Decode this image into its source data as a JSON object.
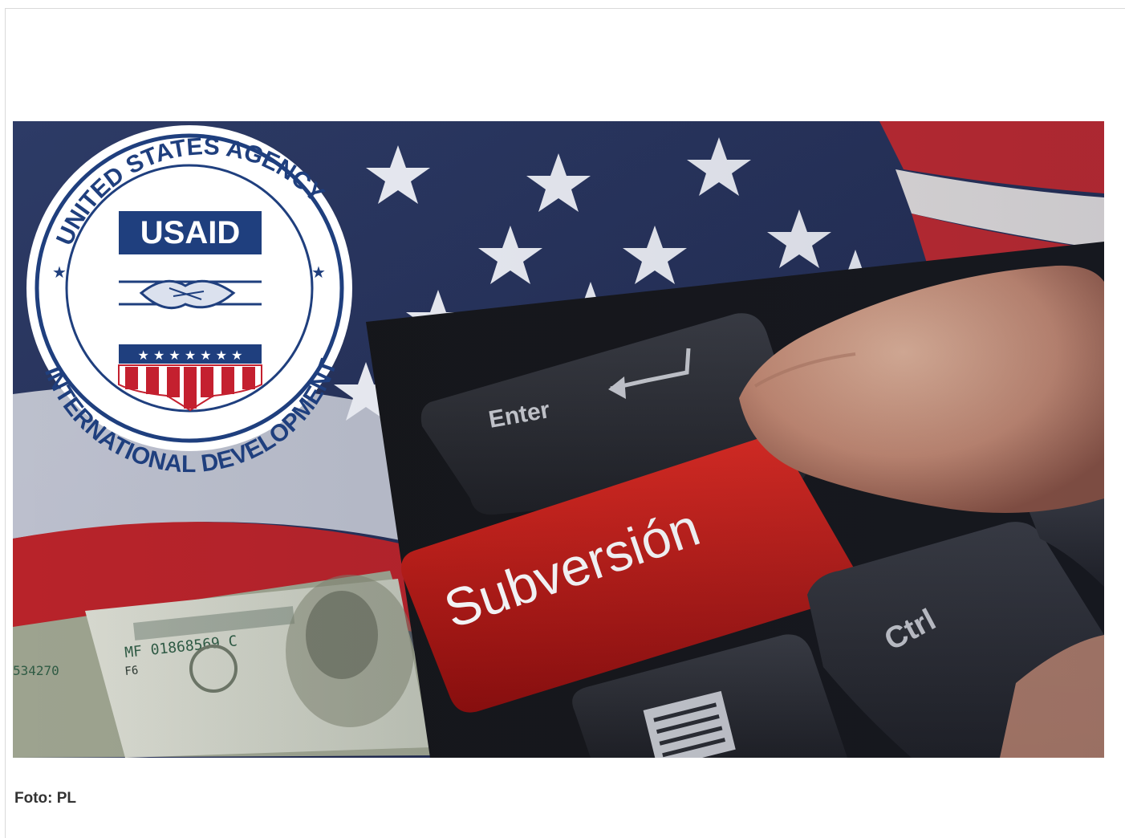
{
  "figure": {
    "caption": "Foto: PL",
    "image": {
      "seal_top_text": "UNITED STATES AGENCY",
      "seal_bottom_text": "INTERNATIONAL DEVELOPMENT",
      "seal_wordmark": "USAID",
      "key_enter": "Enter",
      "key_highlight": "Subversión",
      "key_ctrl": "Ctrl",
      "banknote_serial": "MF 01868569 C",
      "banknote_serial_left": "534270",
      "banknote_code": "F6"
    },
    "colors": {
      "usaid_blue": "#1f3f7e",
      "usaid_red": "#c4202f",
      "key_red": "#c51713",
      "key_dark": "#2a2c31"
    }
  }
}
